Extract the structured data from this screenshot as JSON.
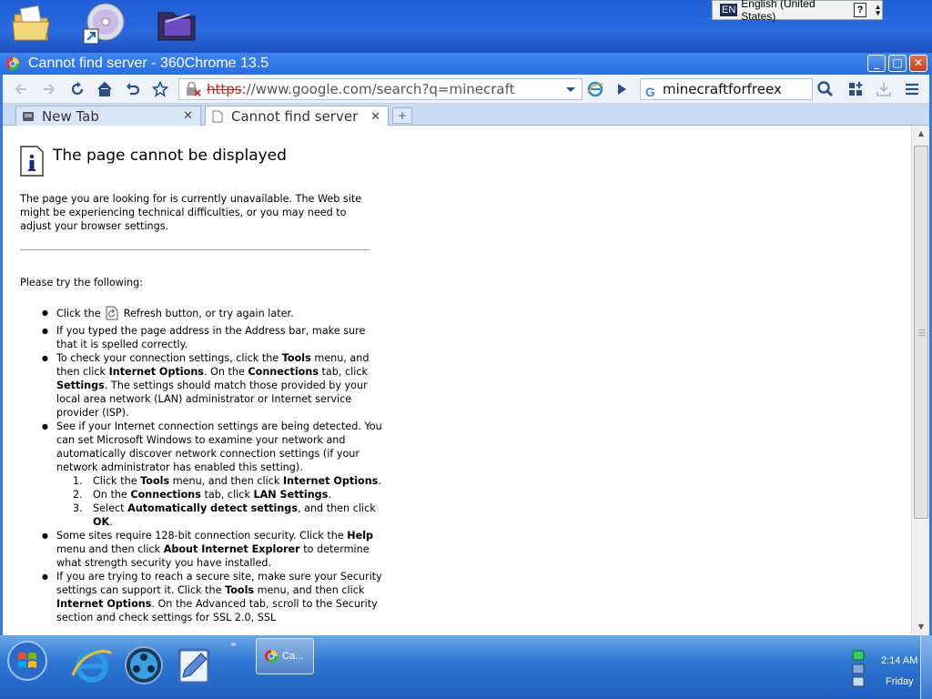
{
  "desktop": {
    "icons": [
      "folder-icon",
      "cd-shortcut-icon",
      "film-folder-icon"
    ],
    "language_bar": {
      "code": "EN",
      "label": "English (United States)",
      "help": "?"
    }
  },
  "window": {
    "title": "Cannot find server - 360Chrome 13.5",
    "minimize": "_",
    "maximize": "□",
    "close": "✕"
  },
  "toolbar": {
    "address_scheme": "https",
    "address_rest": "://www.google.com/search?q=minecraft",
    "search_value": "minecraftforfreex",
    "search_logo": "G"
  },
  "tabs": [
    {
      "label": "New Tab",
      "close": "✕",
      "active": false
    },
    {
      "label": "Cannot find server",
      "close": "✕",
      "active": true
    }
  ],
  "new_tab": "+",
  "page": {
    "heading": "The page cannot be displayed",
    "intro": "The page you are looking for is currently unavailable. The Web site might be experiencing technical difficulties, or you may need to adjust your browser settings.",
    "try_label": "Please try the following:",
    "tip1_a": "Click the ",
    "tip1_b": " Refresh button, or try again later.",
    "tip2": "If you typed the page address in the Address bar, make sure that it is spelled correctly.",
    "tip3_a": "To check your connection settings, click the ",
    "tip3_tools": "Tools",
    "tip3_b": " menu, and then click ",
    "tip3_io": "Internet Options",
    "tip3_c": ". On the ",
    "tip3_conn": "Connections",
    "tip3_d": " tab, click ",
    "tip3_settings": "Settings",
    "tip3_e": ". The settings should match those provided by your local area network (LAN) administrator or Internet service provider (ISP).",
    "tip4": "See if your Internet connection settings are being detected. You can set Microsoft Windows to examine your network and automatically discover network connection settings (if your network administrator has enabled this setting).",
    "step1_a": "Click the ",
    "step1_tools": "Tools",
    "step1_b": " menu, and then click ",
    "step1_io": "Internet Options",
    "step1_c": ".",
    "step2_a": "On the ",
    "step2_conn": "Connections",
    "step2_b": " tab, click ",
    "step2_lan": "LAN Settings",
    "step2_c": ".",
    "step3_a": "Select ",
    "step3_auto": "Automatically detect settings",
    "step3_b": ", and then click ",
    "step3_ok": "OK",
    "step3_c": ".",
    "tip5_a": "Some sites require 128-bit connection security. Click the ",
    "tip5_help": "Help",
    "tip5_b": " menu and then click ",
    "tip5_about": "About Internet Explorer",
    "tip5_c": " to determine what strength security you have installed.",
    "tip6_a": "If you are trying to reach a secure site, make sure your Security settings can support it. Click the ",
    "tip6_tools": "Tools",
    "tip6_b": " menu, and then click ",
    "tip6_io": "Internet Options",
    "tip6_c": ". On the Advanced tab, scroll to the Security section and check settings for SSL 2.0, SSL"
  },
  "taskbar": {
    "task_label": "Ca...",
    "chevron": "»",
    "clock_time": "2:14 AM",
    "clock_day": "Friday"
  },
  "colors": {
    "titlebar": "#2a6ee0",
    "error_scheme": "#c0281c",
    "taskbar": "#1f5fc0"
  }
}
